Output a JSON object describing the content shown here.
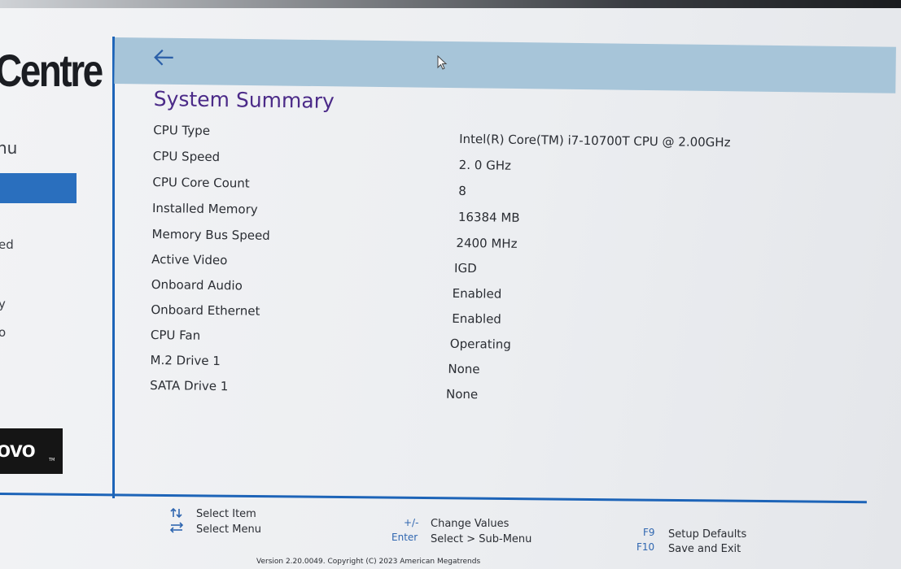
{
  "sidebar": {
    "brand_text": "Centre",
    "menu_label": "nu",
    "item_1": "ed",
    "item_2": "y",
    "item_3": "o",
    "logo_text": "ovo",
    "logo_tm": "TM"
  },
  "header": {
    "back_icon": "back-arrow-icon"
  },
  "summary": {
    "title": "System Summary",
    "rows": [
      {
        "label": "CPU Type",
        "value": "Intel(R) Core(TM) i7-10700T CPU @ 2.00GHz"
      },
      {
        "label": "CPU Speed",
        "value": "2. 0 GHz"
      },
      {
        "label": "CPU Core Count",
        "value": "8"
      },
      {
        "label": "Installed Memory",
        "value": "16384 MB"
      },
      {
        "label": "Memory Bus Speed",
        "value": "2400 MHz"
      },
      {
        "label": "Active Video",
        "value": "IGD"
      },
      {
        "label": "Onboard Audio",
        "value": "Enabled"
      },
      {
        "label": "Onboard Ethernet",
        "value": "Enabled"
      },
      {
        "label": "CPU Fan",
        "value": "Operating"
      },
      {
        "label": "M.2 Drive 1",
        "value": "None"
      },
      {
        "label": "SATA Drive 1",
        "value": "None"
      }
    ]
  },
  "footer": {
    "select_item": "Select Item",
    "select_menu": "Select Menu",
    "plus_minus_key": "+/-",
    "change_values": "Change Values",
    "enter_key": "Enter",
    "select_submenu": "Select > Sub-Menu",
    "f9_key": "F9",
    "setup_defaults": "Setup Defaults",
    "f10_key": "F10",
    "save_exit": "Save and Exit",
    "version": "Version 2.20.0049. Copyright (C) 2023 American Megatrends"
  },
  "colors": {
    "accent_blue": "#1d64b8",
    "header_bar": "#a7c5d9",
    "title_purple": "#4b2a88",
    "key_blue": "#2f66b0"
  }
}
